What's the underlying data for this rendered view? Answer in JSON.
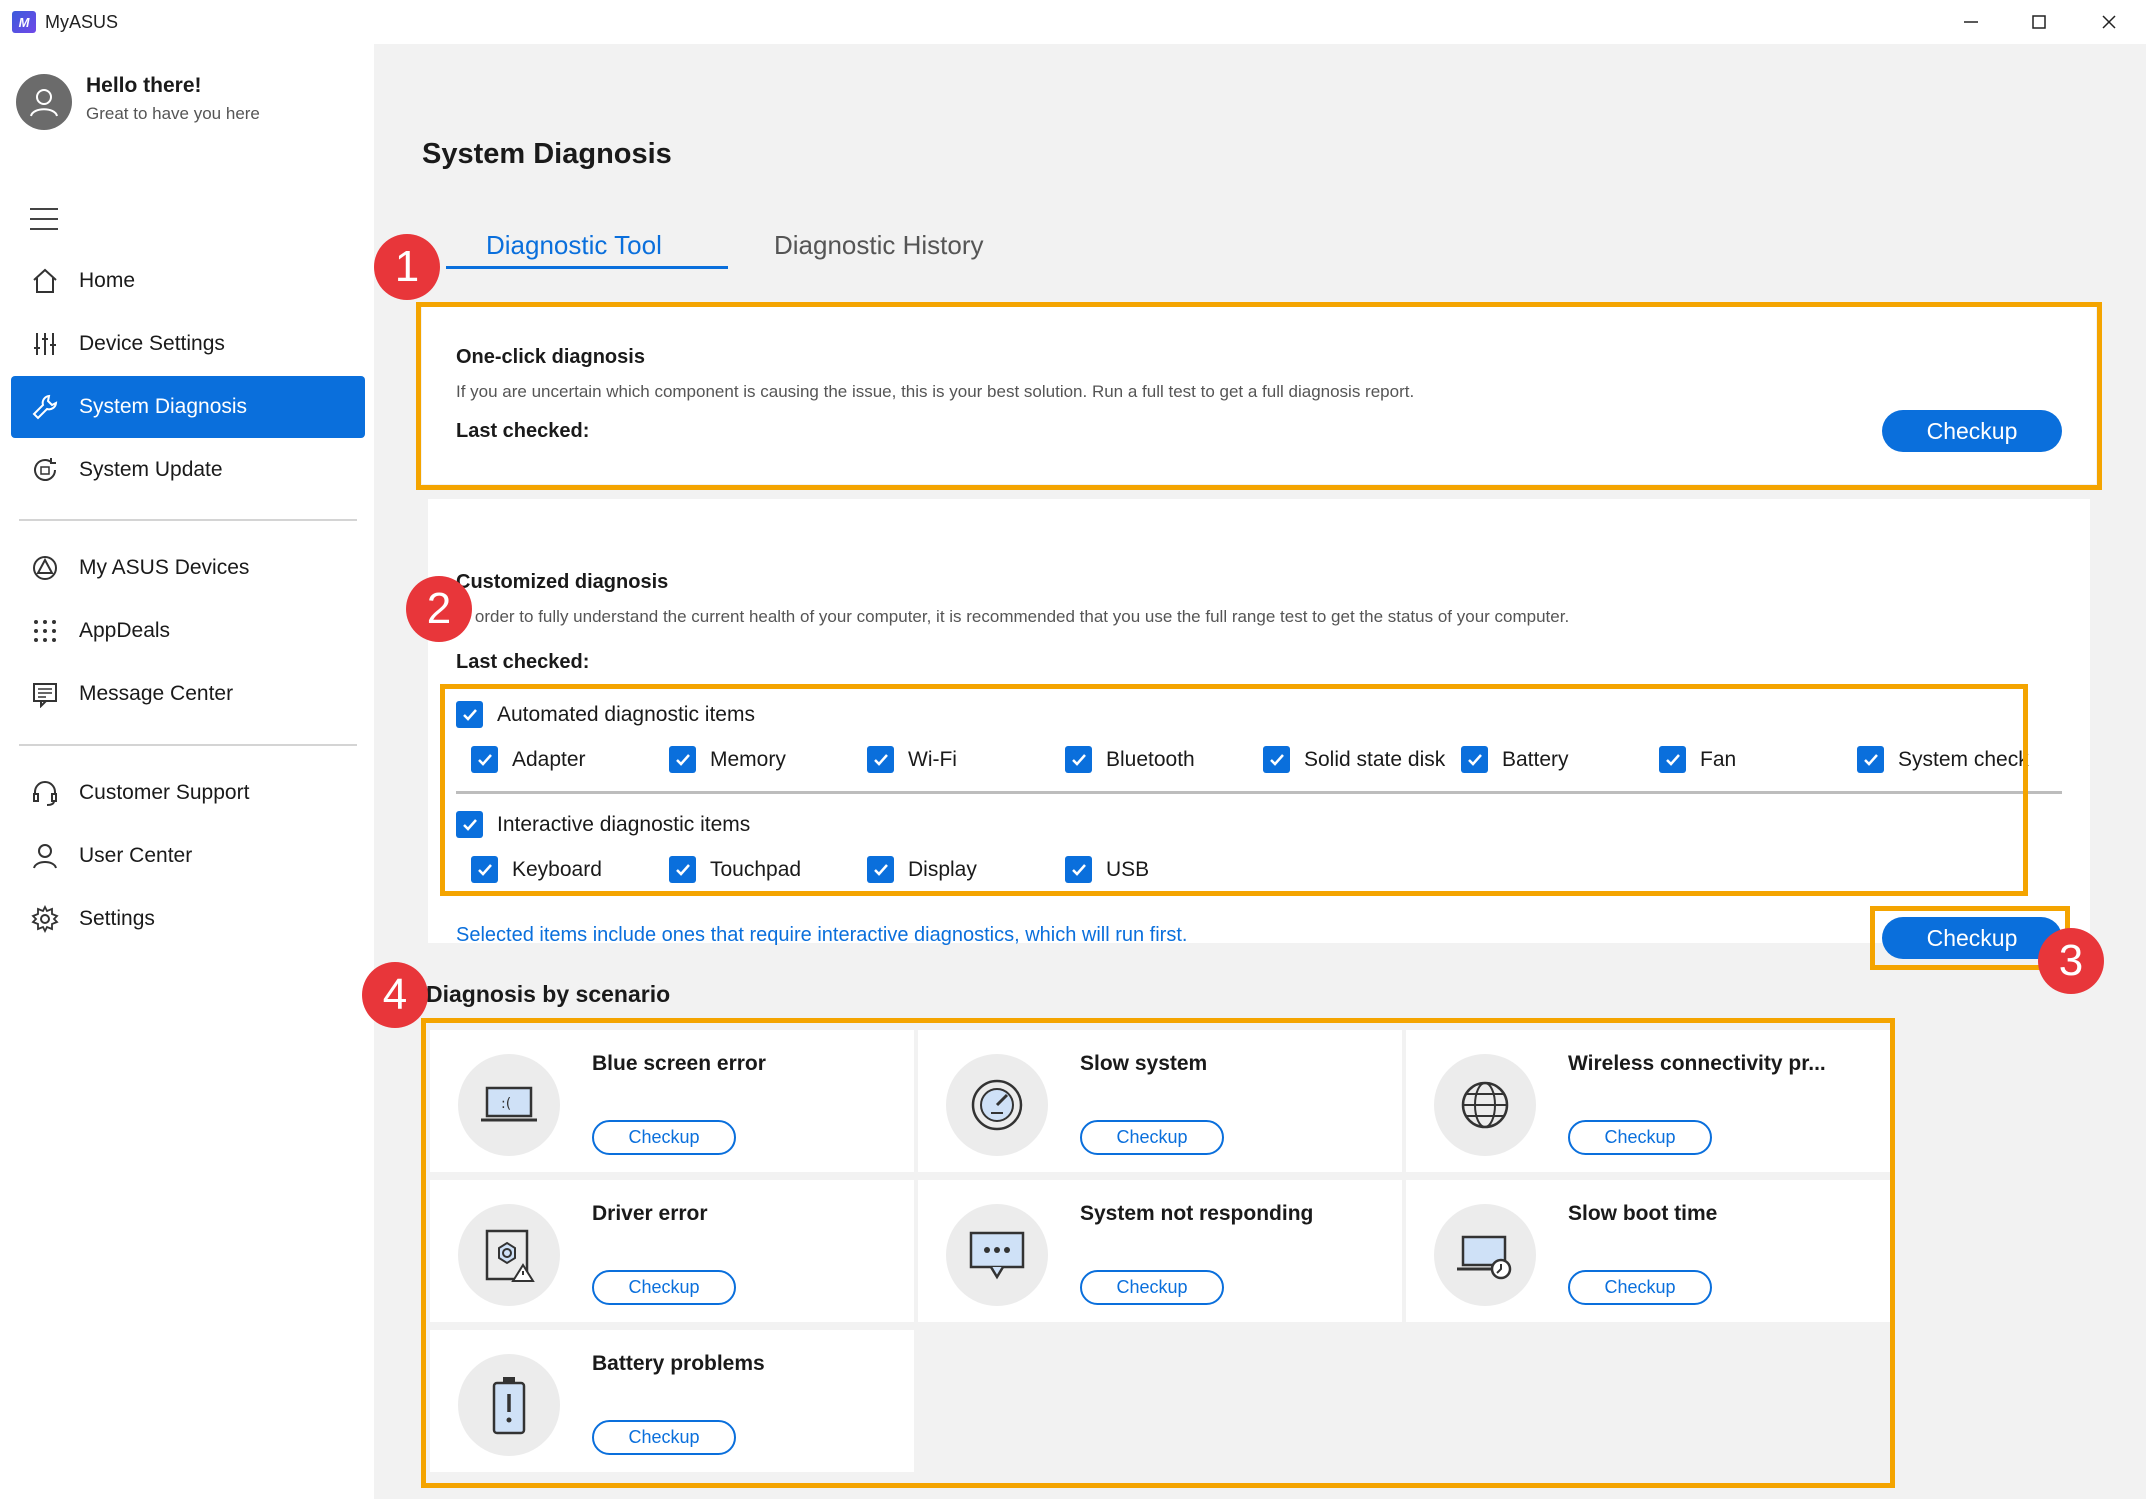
{
  "window": {
    "title": "MyASUS",
    "logo_text": "M"
  },
  "user": {
    "greeting": "Hello there!",
    "subtitle": "Great to have you here"
  },
  "sidebar": {
    "items": [
      {
        "label": "Home",
        "icon": "home-icon"
      },
      {
        "label": "Device Settings",
        "icon": "sliders-icon"
      },
      {
        "label": "System Diagnosis",
        "icon": "wrench-icon",
        "active": true
      },
      {
        "label": "System Update",
        "icon": "update-icon"
      },
      {
        "label": "My ASUS Devices",
        "icon": "devices-icon"
      },
      {
        "label": "AppDeals",
        "icon": "grid-dots-icon"
      },
      {
        "label": "Message Center",
        "icon": "message-icon"
      },
      {
        "label": "Customer Support",
        "icon": "headset-icon"
      },
      {
        "label": "User Center",
        "icon": "user-icon"
      },
      {
        "label": "Settings",
        "icon": "gear-icon"
      }
    ]
  },
  "main": {
    "title": "System Diagnosis",
    "tabs": [
      {
        "label": "Diagnostic Tool",
        "active": true
      },
      {
        "label": "Diagnostic History",
        "active": false
      }
    ],
    "one_click": {
      "title": "One-click diagnosis",
      "description": "If you are uncertain which component is causing the issue, this is your best solution. Run a full test to get a full diagnosis report.",
      "last_checked": "Last checked:",
      "button": "Checkup"
    },
    "customized": {
      "title": "Customized diagnosis",
      "description": "In order to fully understand the current health of your computer, it is recommended that you use the full range test to get the status of your computer.",
      "last_checked": "Last checked:",
      "automated_group": "Automated diagnostic items",
      "automated_items": [
        "Adapter",
        "Memory",
        "Wi-Fi",
        "Bluetooth",
        "Solid state disk",
        "Battery",
        "Fan",
        "System check"
      ],
      "interactive_group": "Interactive diagnostic items",
      "interactive_items": [
        "Keyboard",
        "Touchpad",
        "Display",
        "USB"
      ],
      "info": "Selected items include ones that require interactive diagnostics, which will run first.",
      "button": "Checkup"
    },
    "scenario": {
      "title": "Diagnosis by scenario",
      "items": [
        {
          "title": "Blue screen error",
          "button": "Checkup",
          "icon": "laptop-sad-icon"
        },
        {
          "title": "Slow system",
          "button": "Checkup",
          "icon": "speedometer-icon"
        },
        {
          "title": "Wireless connectivity pr...",
          "button": "Checkup",
          "icon": "globe-icon"
        },
        {
          "title": "Driver error",
          "button": "Checkup",
          "icon": "driver-warning-icon"
        },
        {
          "title": "System not responding",
          "button": "Checkup",
          "icon": "chat-dots-icon"
        },
        {
          "title": "Slow boot time",
          "button": "Checkup",
          "icon": "laptop-clock-icon"
        },
        {
          "title": "Battery problems",
          "button": "Checkup",
          "icon": "battery-alert-icon"
        }
      ]
    }
  },
  "annotations": [
    "1",
    "2",
    "3",
    "4"
  ],
  "colors": {
    "accent": "#0a6fdc",
    "highlight": "#f4a400",
    "badge": "#e8363a"
  }
}
